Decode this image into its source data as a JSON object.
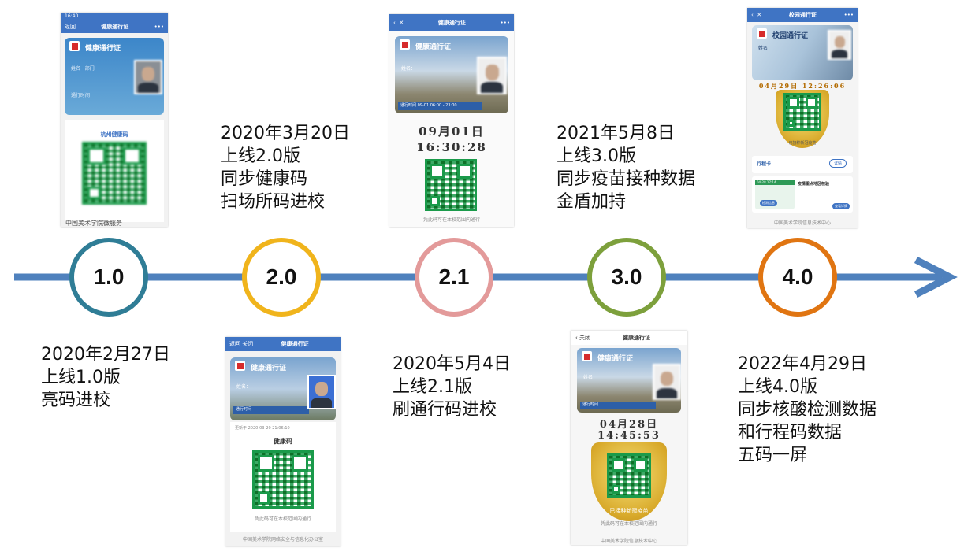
{
  "timeline": {
    "nodes": [
      {
        "label": "1.0",
        "color": "#2f7d96"
      },
      {
        "label": "2.0",
        "color": "#f0b41c"
      },
      {
        "label": "2.1",
        "color": "#e39a9a"
      },
      {
        "label": "3.0",
        "color": "#7da03c"
      },
      {
        "label": "4.0",
        "color": "#e07512"
      }
    ],
    "arrow_color": "#4f81bd"
  },
  "captions": [
    {
      "lines": [
        "2020年2月27日",
        "上线1.0版",
        "亮码进校"
      ]
    },
    {
      "lines": [
        "2020年3月20日",
        "上线2.0版",
        "同步健康码",
        "扫场所码进校"
      ]
    },
    {
      "lines": [
        "2020年5月4日",
        "上线2.1版",
        "刷通行码进校"
      ]
    },
    {
      "lines": [
        "2021年5月8日",
        "上线3.0版",
        "同步疫苗接种数据",
        "金盾加持"
      ]
    },
    {
      "lines": [
        "2022年4月29日",
        "上线4.0版",
        "同步核酸检测数据",
        "和行程码数据",
        "五码一屏"
      ]
    }
  ],
  "screens": {
    "s1": {
      "time": "16:40",
      "back": "返回",
      "title": "健康通行证",
      "menu": "•••",
      "card_title": "健康通行证",
      "name_label": "姓名",
      "dept": "部门",
      "valid_label": "通行时间",
      "code_title": "杭州健康码",
      "watermark": "中国美术学院微服务"
    },
    "s2": {
      "back": "返回",
      "close": "关闭",
      "title": "健康通行证",
      "card_title": "健康通行证",
      "name_label": "姓名：",
      "valid_label": "通行时间",
      "updated": "更新于 2020-03-20 21:06:10",
      "code_title": "健康码",
      "note": "凭此码可在本校范围内通行",
      "footer": "中国美术学院网络安全与信息化办公室"
    },
    "s3": {
      "title": "健康通行证",
      "menu": "•••",
      "card_title": "健康通行证",
      "name_label": "姓名：",
      "valid_label": "通行时间",
      "valid_time": "09-01 06:00 - 23:00",
      "date": "09月01日",
      "time": "16:30:28",
      "note": "凭此码可在本校范围内通行"
    },
    "s4": {
      "back": "关闭",
      "title": "健康通行证",
      "card_title": "健康通行证",
      "name_label": "姓名：",
      "valid_label": "通行时间",
      "date": "04月28日",
      "time": "14:45:53",
      "badge": "已接种新冠疫苗",
      "note": "凭此码可在本校范围内通行",
      "footer": "中国美术学院信息技术中心"
    },
    "s5": {
      "title": "校园通行证",
      "menu": "•••",
      "card_title": "校园通行证",
      "name_label": "姓名：",
      "datetime": "04月29日 12:26:06",
      "badge": "已接种新冠疫苗",
      "trip_title": "行程卡",
      "trip_btn": "详情",
      "nat_title": "疫情重点地区核验",
      "nat_time": "04-28 17:14",
      "nat_btn1": "检测信息",
      "nat_btn2": "查看详情",
      "footer": "中国美术学院信息技术中心"
    }
  }
}
